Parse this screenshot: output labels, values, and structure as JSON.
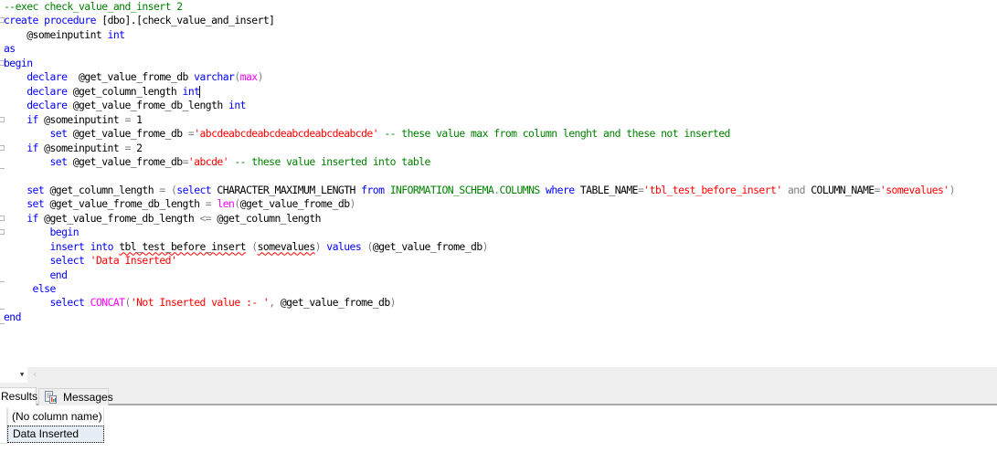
{
  "editor": {
    "lines": [
      {
        "fold": "",
        "tokens": [
          {
            "t": "--exec check_value_and_insert 2",
            "c": "cm"
          }
        ]
      },
      {
        "fold": "open",
        "tokens": [
          {
            "t": "create",
            "c": "kw"
          },
          {
            "t": " ",
            "c": "id"
          },
          {
            "t": "procedure",
            "c": "kw"
          },
          {
            "t": " [dbo].[check_value_and_insert]",
            "c": "id"
          }
        ]
      },
      {
        "fold": "",
        "tokens": [
          {
            "t": "    @someinputint ",
            "c": "id"
          },
          {
            "t": "int",
            "c": "ty"
          }
        ]
      },
      {
        "fold": "",
        "tokens": [
          {
            "t": "as",
            "c": "kw"
          }
        ]
      },
      {
        "fold": "open",
        "tokens": [
          {
            "t": "begin",
            "c": "kw"
          }
        ]
      },
      {
        "fold": "",
        "tokens": [
          {
            "t": "    ",
            "c": "id"
          },
          {
            "t": "declare",
            "c": "kw"
          },
          {
            "t": "  @get_value_frome_db ",
            "c": "id"
          },
          {
            "t": "varchar",
            "c": "ty"
          },
          {
            "t": "(",
            "c": "op"
          },
          {
            "t": "max",
            "c": "fn"
          },
          {
            "t": ")",
            "c": "op"
          }
        ]
      },
      {
        "fold": "",
        "tokens": [
          {
            "t": "    ",
            "c": "id"
          },
          {
            "t": "declare",
            "c": "kw"
          },
          {
            "t": " @get_column_length ",
            "c": "id"
          },
          {
            "t": "int",
            "c": "ty"
          }
        ],
        "caret": true
      },
      {
        "fold": "",
        "tokens": [
          {
            "t": "    ",
            "c": "id"
          },
          {
            "t": "declare",
            "c": "kw"
          },
          {
            "t": " @get_value_frome_db_length ",
            "c": "id"
          },
          {
            "t": "int",
            "c": "ty"
          }
        ]
      },
      {
        "fold": "open",
        "tokens": [
          {
            "t": "    ",
            "c": "id"
          },
          {
            "t": "if",
            "c": "kw"
          },
          {
            "t": " @someinputint ",
            "c": "id"
          },
          {
            "t": "=",
            "c": "op"
          },
          {
            "t": " 1",
            "c": "id"
          }
        ]
      },
      {
        "fold": "",
        "tokens": [
          {
            "t": "        ",
            "c": "id"
          },
          {
            "t": "set",
            "c": "kw"
          },
          {
            "t": " @get_value_frome_db ",
            "c": "id"
          },
          {
            "t": "=",
            "c": "op"
          },
          {
            "t": "'abcdeabcdeabcdeabcdeabcdeabcde'",
            "c": "str"
          },
          {
            "t": " -- these value max from column lenght and these not inserted",
            "c": "cm"
          }
        ]
      },
      {
        "fold": "open",
        "tokens": [
          {
            "t": "    ",
            "c": "id"
          },
          {
            "t": "if",
            "c": "kw"
          },
          {
            "t": " @someinputint ",
            "c": "id"
          },
          {
            "t": "=",
            "c": "op"
          },
          {
            "t": " 2",
            "c": "id"
          }
        ]
      },
      {
        "fold": "end",
        "tokens": [
          {
            "t": "        ",
            "c": "id"
          },
          {
            "t": "set",
            "c": "kw"
          },
          {
            "t": " @get_value_frome_db",
            "c": "id"
          },
          {
            "t": "=",
            "c": "op"
          },
          {
            "t": "'abcde'",
            "c": "str"
          },
          {
            "t": " -- these value inserted into table",
            "c": "cm"
          }
        ]
      },
      {
        "fold": "",
        "tokens": []
      },
      {
        "fold": "",
        "tokens": [
          {
            "t": "    ",
            "c": "id"
          },
          {
            "t": "set",
            "c": "kw"
          },
          {
            "t": " @get_column_length ",
            "c": "id"
          },
          {
            "t": "=",
            "c": "op"
          },
          {
            "t": " ",
            "c": "id"
          },
          {
            "t": "(",
            "c": "op"
          },
          {
            "t": "select",
            "c": "kw"
          },
          {
            "t": " CHARACTER_MAXIMUM_LENGTH ",
            "c": "id"
          },
          {
            "t": "from",
            "c": "kw"
          },
          {
            "t": " ",
            "c": "id"
          },
          {
            "t": "INFORMATION_SCHEMA",
            "c": "sys"
          },
          {
            "t": ".",
            "c": "op"
          },
          {
            "t": "COLUMNS",
            "c": "sys"
          },
          {
            "t": " ",
            "c": "id"
          },
          {
            "t": "where",
            "c": "kw"
          },
          {
            "t": " TABLE_NAME",
            "c": "id"
          },
          {
            "t": "=",
            "c": "op"
          },
          {
            "t": "'tbl_test_before_insert'",
            "c": "str"
          },
          {
            "t": " ",
            "c": "id"
          },
          {
            "t": "and",
            "c": "op"
          },
          {
            "t": " COLUMN_NAME",
            "c": "id"
          },
          {
            "t": "=",
            "c": "op"
          },
          {
            "t": "'somevalues'",
            "c": "str"
          },
          {
            "t": ")",
            "c": "op"
          }
        ]
      },
      {
        "fold": "",
        "tokens": [
          {
            "t": "    ",
            "c": "id"
          },
          {
            "t": "set",
            "c": "kw"
          },
          {
            "t": " @get_value_frome_db_length ",
            "c": "id"
          },
          {
            "t": "=",
            "c": "op"
          },
          {
            "t": " ",
            "c": "id"
          },
          {
            "t": "len",
            "c": "fn"
          },
          {
            "t": "(",
            "c": "op"
          },
          {
            "t": "@get_value_frome_db",
            "c": "id"
          },
          {
            "t": ")",
            "c": "op"
          }
        ]
      },
      {
        "fold": "open",
        "tokens": [
          {
            "t": "    ",
            "c": "id"
          },
          {
            "t": "if",
            "c": "kw"
          },
          {
            "t": " @get_value_frome_db_length ",
            "c": "id"
          },
          {
            "t": "<=",
            "c": "op"
          },
          {
            "t": " @get_column_length",
            "c": "id"
          }
        ]
      },
      {
        "fold": "open",
        "tokens": [
          {
            "t": "        ",
            "c": "id"
          },
          {
            "t": "begin",
            "c": "kw"
          }
        ]
      },
      {
        "fold": "",
        "tokens": [
          {
            "t": "        ",
            "c": "id"
          },
          {
            "t": "insert",
            "c": "kw"
          },
          {
            "t": " ",
            "c": "id"
          },
          {
            "t": "into",
            "c": "kw"
          },
          {
            "t": " ",
            "c": "id"
          },
          {
            "t": "tbl_test_before_insert",
            "c": "id sq"
          },
          {
            "t": " ",
            "c": "id"
          },
          {
            "t": "(",
            "c": "op"
          },
          {
            "t": "somevalues",
            "c": "id sq"
          },
          {
            "t": ")",
            "c": "op"
          },
          {
            "t": " ",
            "c": "id"
          },
          {
            "t": "values",
            "c": "kw"
          },
          {
            "t": " ",
            "c": "id"
          },
          {
            "t": "(",
            "c": "op"
          },
          {
            "t": "@get_value_frome_db",
            "c": "id"
          },
          {
            "t": ")",
            "c": "op"
          }
        ]
      },
      {
        "fold": "",
        "tokens": [
          {
            "t": "        ",
            "c": "id"
          },
          {
            "t": "select",
            "c": "kw"
          },
          {
            "t": " ",
            "c": "id"
          },
          {
            "t": "'Data Inserted'",
            "c": "str"
          }
        ]
      },
      {
        "fold": "end",
        "tokens": [
          {
            "t": "        ",
            "c": "id"
          },
          {
            "t": "end",
            "c": "kw"
          }
        ]
      },
      {
        "fold": "",
        "tokens": [
          {
            "t": "     ",
            "c": "id"
          },
          {
            "t": "else",
            "c": "kw"
          }
        ]
      },
      {
        "fold": "end",
        "tokens": [
          {
            "t": "        ",
            "c": "id"
          },
          {
            "t": "select",
            "c": "kw"
          },
          {
            "t": " ",
            "c": "id"
          },
          {
            "t": "CONCAT",
            "c": "fn"
          },
          {
            "t": "(",
            "c": "op"
          },
          {
            "t": "'Not Inserted value :- '",
            "c": "str"
          },
          {
            "t": ",",
            "c": "op"
          },
          {
            "t": " @get_value_frome_db",
            "c": "id"
          },
          {
            "t": ")",
            "c": "op"
          }
        ]
      },
      {
        "fold": "end",
        "tokens": [
          {
            "t": "end",
            "c": "kw"
          }
        ]
      }
    ]
  },
  "bottom_bar": {
    "zoom_dropdown_value": "",
    "scroll_left_glyph": "‹"
  },
  "result_tabs": [
    {
      "label": "Results",
      "active": true,
      "icon": "grid-icon"
    },
    {
      "label": "Messages",
      "active": false,
      "icon": "messages-icon"
    }
  ],
  "results_grid": {
    "columns": [
      "(No column name)"
    ],
    "rows": [
      [
        "Data Inserted"
      ]
    ]
  },
  "colors": {
    "keyword": "#0000ff",
    "string": "#ff0000",
    "comment": "#008000",
    "function": "#ff00ff",
    "operator": "#808080",
    "selected_cell": "#e6edf4"
  }
}
